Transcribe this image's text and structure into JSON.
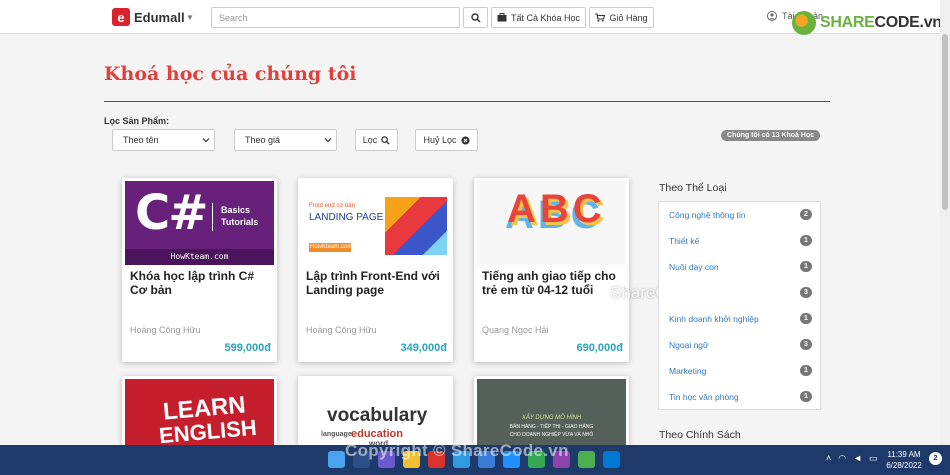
{
  "header": {
    "logo_text": "Edumall",
    "search_placeholder": "Search",
    "all_courses_label": "Tất Cả Khóa Học",
    "cart_label": "Giỏ Hàng",
    "account_label": "Tài Khoản"
  },
  "watermark": {
    "brand_left": "SHARE",
    "brand_right": "CODE.vn",
    "center_text": "ShareCode.vn",
    "footer_text": "Copyright © ShareCode.vn"
  },
  "main": {
    "title": "Khoá học của chúng tôi",
    "filter_label": "Lọc Sản Phẩm:",
    "sort_name": "Theo tên",
    "sort_price": "Theo giá",
    "filter_button": "Lọc",
    "reset_button": "Huỷ Lọc",
    "course_count_text": "Chúng tôi có 13 Khoá Học"
  },
  "courses": [
    {
      "title": "Khóa học lập trình C# Cơ bản",
      "author": "Hoàng Công Hữu",
      "price": "599,000đ",
      "thumb": {
        "big": "C#",
        "line1": "Basics",
        "line2": "Tutorials",
        "footer": "HowKteam.com"
      }
    },
    {
      "title": "Lập trình Front-End với Landing page",
      "author": "Hoàng Công Hữu",
      "price": "349,000đ",
      "thumb": {
        "kicker": "Front end cơ bản",
        "big": "LANDING PAGE",
        "footer": "HowKteam.com"
      }
    },
    {
      "title": "Tiếng anh giao tiếp cho trẻ em từ 04-12 tuổi",
      "author": "Quang Ngọc Hải",
      "price": "690,000đ",
      "thumb": {
        "letters": "ABC"
      }
    },
    {
      "thumb": {
        "line1": "LEARN",
        "line2": "ENGLISH"
      }
    },
    {
      "thumb": {
        "word": "vocabulary",
        "sub1": "language",
        "sub2": "education",
        "sub3": "word"
      }
    },
    {
      "thumb": {
        "line1": "XÂY DỰNG MÔ HÌNH",
        "line2": "BÁN HÀNG - TIẾP THỊ - GIAO HÀNG",
        "line3": "CHO DOANH NGHIỆP VỪA VÀ NHỎ"
      }
    }
  ],
  "sidebar": {
    "category_heading": "Theo Thể Loại",
    "categories": [
      {
        "label": "Công nghệ thông tin",
        "count": "2"
      },
      {
        "label": "Thiết kế",
        "count": "1"
      },
      {
        "label": "Nuôi dạy con",
        "count": "1"
      },
      {
        "label": "",
        "count": "3"
      },
      {
        "label": "Kinh doanh khởi nghiệp",
        "count": "1"
      },
      {
        "label": "Ngoại ngữ",
        "count": "3"
      },
      {
        "label": "Marketing",
        "count": "1"
      },
      {
        "label": "Tin học văn phòng",
        "count": "1"
      }
    ],
    "policy_heading": "Theo Chính Sách"
  },
  "taskbar": {
    "time": "11:39 AM",
    "date": "6/28/2022",
    "notification_count": "2"
  }
}
